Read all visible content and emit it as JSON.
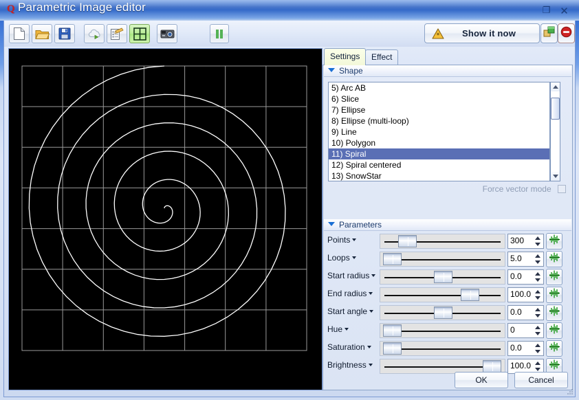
{
  "window": {
    "title": "Parametric Image editor",
    "app_icon": "Q",
    "maximize_label": "❐",
    "close_label": "✕"
  },
  "toolbar": {
    "buttons": [
      {
        "name": "new-file-button",
        "icon": "new-file-icon"
      },
      {
        "name": "open-file-button",
        "icon": "open-folder-icon"
      },
      {
        "name": "save-file-button",
        "icon": "save-disk-icon"
      },
      {
        "name": "upload-button",
        "icon": "cloud-upload-icon"
      },
      {
        "name": "edit-list-button",
        "icon": "clipboard-pencil-icon"
      },
      {
        "name": "grid-button",
        "icon": "grid-icon",
        "active": true
      },
      {
        "name": "camera-button",
        "icon": "camera-icon"
      },
      {
        "name": "pause-button",
        "icon": "pause-icon"
      }
    ],
    "show_it_now_label": "Show it now",
    "show_it_now_icon": "warning-triangle-icon",
    "copy_icon": "copy-windows-icon",
    "stop_icon": "stop-sign-icon"
  },
  "canvas": {
    "background": "#000000",
    "grid_color": "#9a9a9a",
    "curve_color": "#ffffff",
    "grid_cols": 7,
    "grid_rows": 7
  },
  "tabs": [
    {
      "label": "Settings",
      "selected": true
    },
    {
      "label": "Effect",
      "selected": false
    }
  ],
  "shape_group": {
    "header": "Shape",
    "items": [
      "5) Arc AB",
      "6) Slice",
      "7) Ellipse",
      "8) Ellipse (multi-loop)",
      "9) Line",
      "10) Polygon",
      "11) Spiral",
      "12) Spiral centered",
      "13) SnowStar"
    ],
    "selected_index": 6,
    "force_vector_mode_label": "Force vector mode",
    "force_vector_mode_checked": false
  },
  "parameters_group": {
    "header": "Parameters",
    "rows": [
      {
        "label": "Points",
        "value": "300",
        "slider_pct": 16
      },
      {
        "label": "Loops",
        "value": "5.0",
        "slider_pct": 2
      },
      {
        "label": "Start radius",
        "value": "0.0",
        "slider_pct": 50
      },
      {
        "label": "End radius",
        "value": "100.0",
        "slider_pct": 75
      },
      {
        "label": "Start angle",
        "value": "0.0",
        "slider_pct": 50
      },
      {
        "label": "Hue",
        "value": "0",
        "slider_pct": 2
      },
      {
        "label": "Saturation",
        "value": "0.0",
        "slider_pct": 2
      },
      {
        "label": "Brightness",
        "value": "100.0",
        "slider_pct": 96
      }
    ],
    "wave_button_icon": "green-waveform-icon"
  },
  "footer": {
    "ok_label": "OK",
    "cancel_label": "Cancel"
  },
  "chart_data": {
    "type": "line",
    "title": "Archimedean spiral preview",
    "shape": "11) Spiral",
    "points": 300,
    "loops": 5.0,
    "start_radius": 0.0,
    "end_radius": 100.0,
    "start_angle": 0.0,
    "hue": 0,
    "saturation": 0.0,
    "brightness": 100.0
  }
}
